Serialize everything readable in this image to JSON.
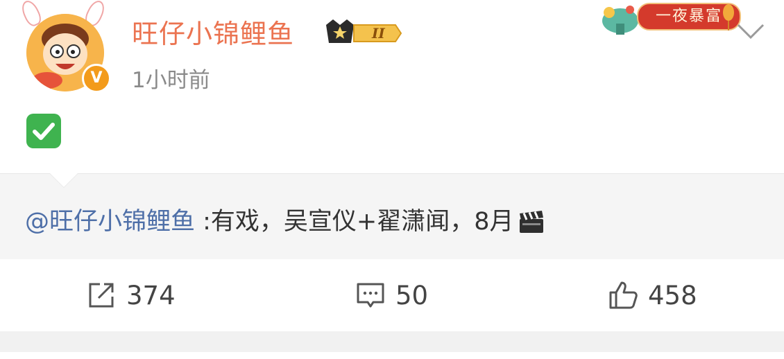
{
  "post": {
    "username": "旺仔小锦鲤鱼",
    "vip_level": "II",
    "time": "1小时前",
    "decor_label": "一夜暴富",
    "content_emoji": "check-mark-emoji"
  },
  "repost": {
    "mention": "@旺仔小锦鲤鱼",
    "text": " :有戏，吴宣仪+翟潇闻，8月",
    "emoji": "clapper-board-emoji"
  },
  "actions": {
    "repost_count": "374",
    "comment_count": "50",
    "like_count": "458"
  },
  "colors": {
    "username": "#eb7350",
    "mention": "#4e6fa8",
    "time": "#8a8a8a",
    "repost_bg": "#f5f5f5"
  }
}
